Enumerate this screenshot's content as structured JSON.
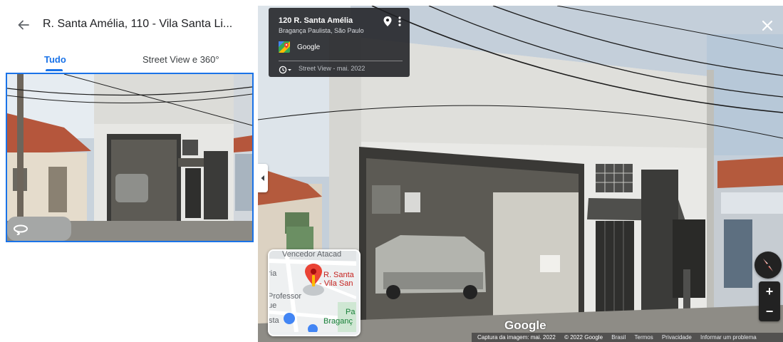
{
  "header": {
    "title": "R. Santa Amélia, 110 - Vila Santa Li..."
  },
  "tabs": [
    {
      "label": "Tudo"
    },
    {
      "label": "Street View e 360°"
    }
  ],
  "info_card": {
    "title": "120 R. Santa Amélia",
    "subtitle": "Bragança Paulista, São Paulo",
    "provider": "Google",
    "date": "Street View - mai. 2022"
  },
  "minimap": {
    "vencedor": "Vencedor Atacad",
    "ria": "ria",
    "place_line1": "R. Santa",
    "place_line2": "- Vila San",
    "professor": "Professor",
    "ue": "ue",
    "pa": "Pa",
    "braganca": "Braganç",
    "sta": "sta"
  },
  "street_view": {
    "watermark": "Google"
  },
  "zoom": {
    "in": "+",
    "out": "−"
  },
  "footer": {
    "capture": "Captura da imagem: mai. 2022",
    "copyright": "© 2022 Google",
    "country": "Brasil",
    "terms": "Termos",
    "privacy": "Privacidade",
    "report": "Informar um problema"
  },
  "colors": {
    "accent": "#1a73e8",
    "pin": "#ea4335",
    "panel_dark": "#202124"
  },
  "icons": [
    "back-arrow-icon",
    "rotate-360-icon",
    "location-pin-icon",
    "more-vert-icon",
    "google-maps-logo-icon",
    "clock-history-icon",
    "close-icon",
    "chevron-left-icon",
    "compass-icon",
    "zoom-in-icon",
    "zoom-out-icon"
  ]
}
